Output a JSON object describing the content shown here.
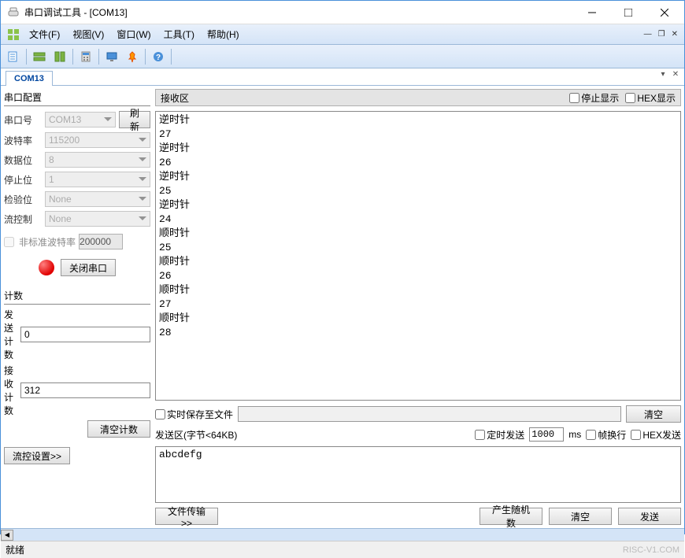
{
  "titlebar": {
    "title": "串口调试工具 - [COM13]"
  },
  "menubar": {
    "file": "文件(F)",
    "view": "视图(V)",
    "window": "窗口(W)",
    "tools": "工具(T)",
    "help": "帮助(H)"
  },
  "tabs": {
    "com13": "COM13"
  },
  "left": {
    "config_title": "串口配置",
    "port_label": "串口号",
    "port_value": "COM13",
    "refresh": "刷新",
    "baud_label": "波特率",
    "baud_value": "115200",
    "databits_label": "数据位",
    "databits_value": "8",
    "stopbits_label": "停止位",
    "stopbits_value": "1",
    "parity_label": "检验位",
    "parity_value": "None",
    "flowctrl_label": "流控制",
    "flowctrl_value": "None",
    "nonstd_label": "非标准波特率",
    "nonstd_value": "200000",
    "close_port": "关闭串口",
    "count_title": "计数",
    "send_count_label": "发送计数",
    "send_count_value": "0",
    "recv_count_label": "接收计数",
    "recv_count_value": "312",
    "clear_count": "清空计数",
    "flow_settings": "流控设置>>"
  },
  "recv": {
    "title": "接收区",
    "stop_display": "停止显示",
    "hex_display": "HEX显示",
    "content": "逆时针\n27\n逆时针\n26\n逆时针\n25\n逆时针\n24\n顺时针\n25\n顺时针\n26\n顺时针\n27\n顺时针\n28",
    "realtime_save": "实时保存至文件",
    "clear": "清空"
  },
  "send": {
    "title": "发送区(字节<64KB)",
    "timed_send": "定时发送",
    "interval": "1000",
    "ms": "ms",
    "frame_wrap": "帧换行",
    "hex_send": "HEX发送",
    "content": "abcdefg",
    "file_transfer": "文件传输>>",
    "gen_random": "产生随机数",
    "clear": "清空",
    "send_btn": "发送"
  },
  "statusbar": {
    "ready": "就绪",
    "watermark": "RISC-V1.COM"
  }
}
